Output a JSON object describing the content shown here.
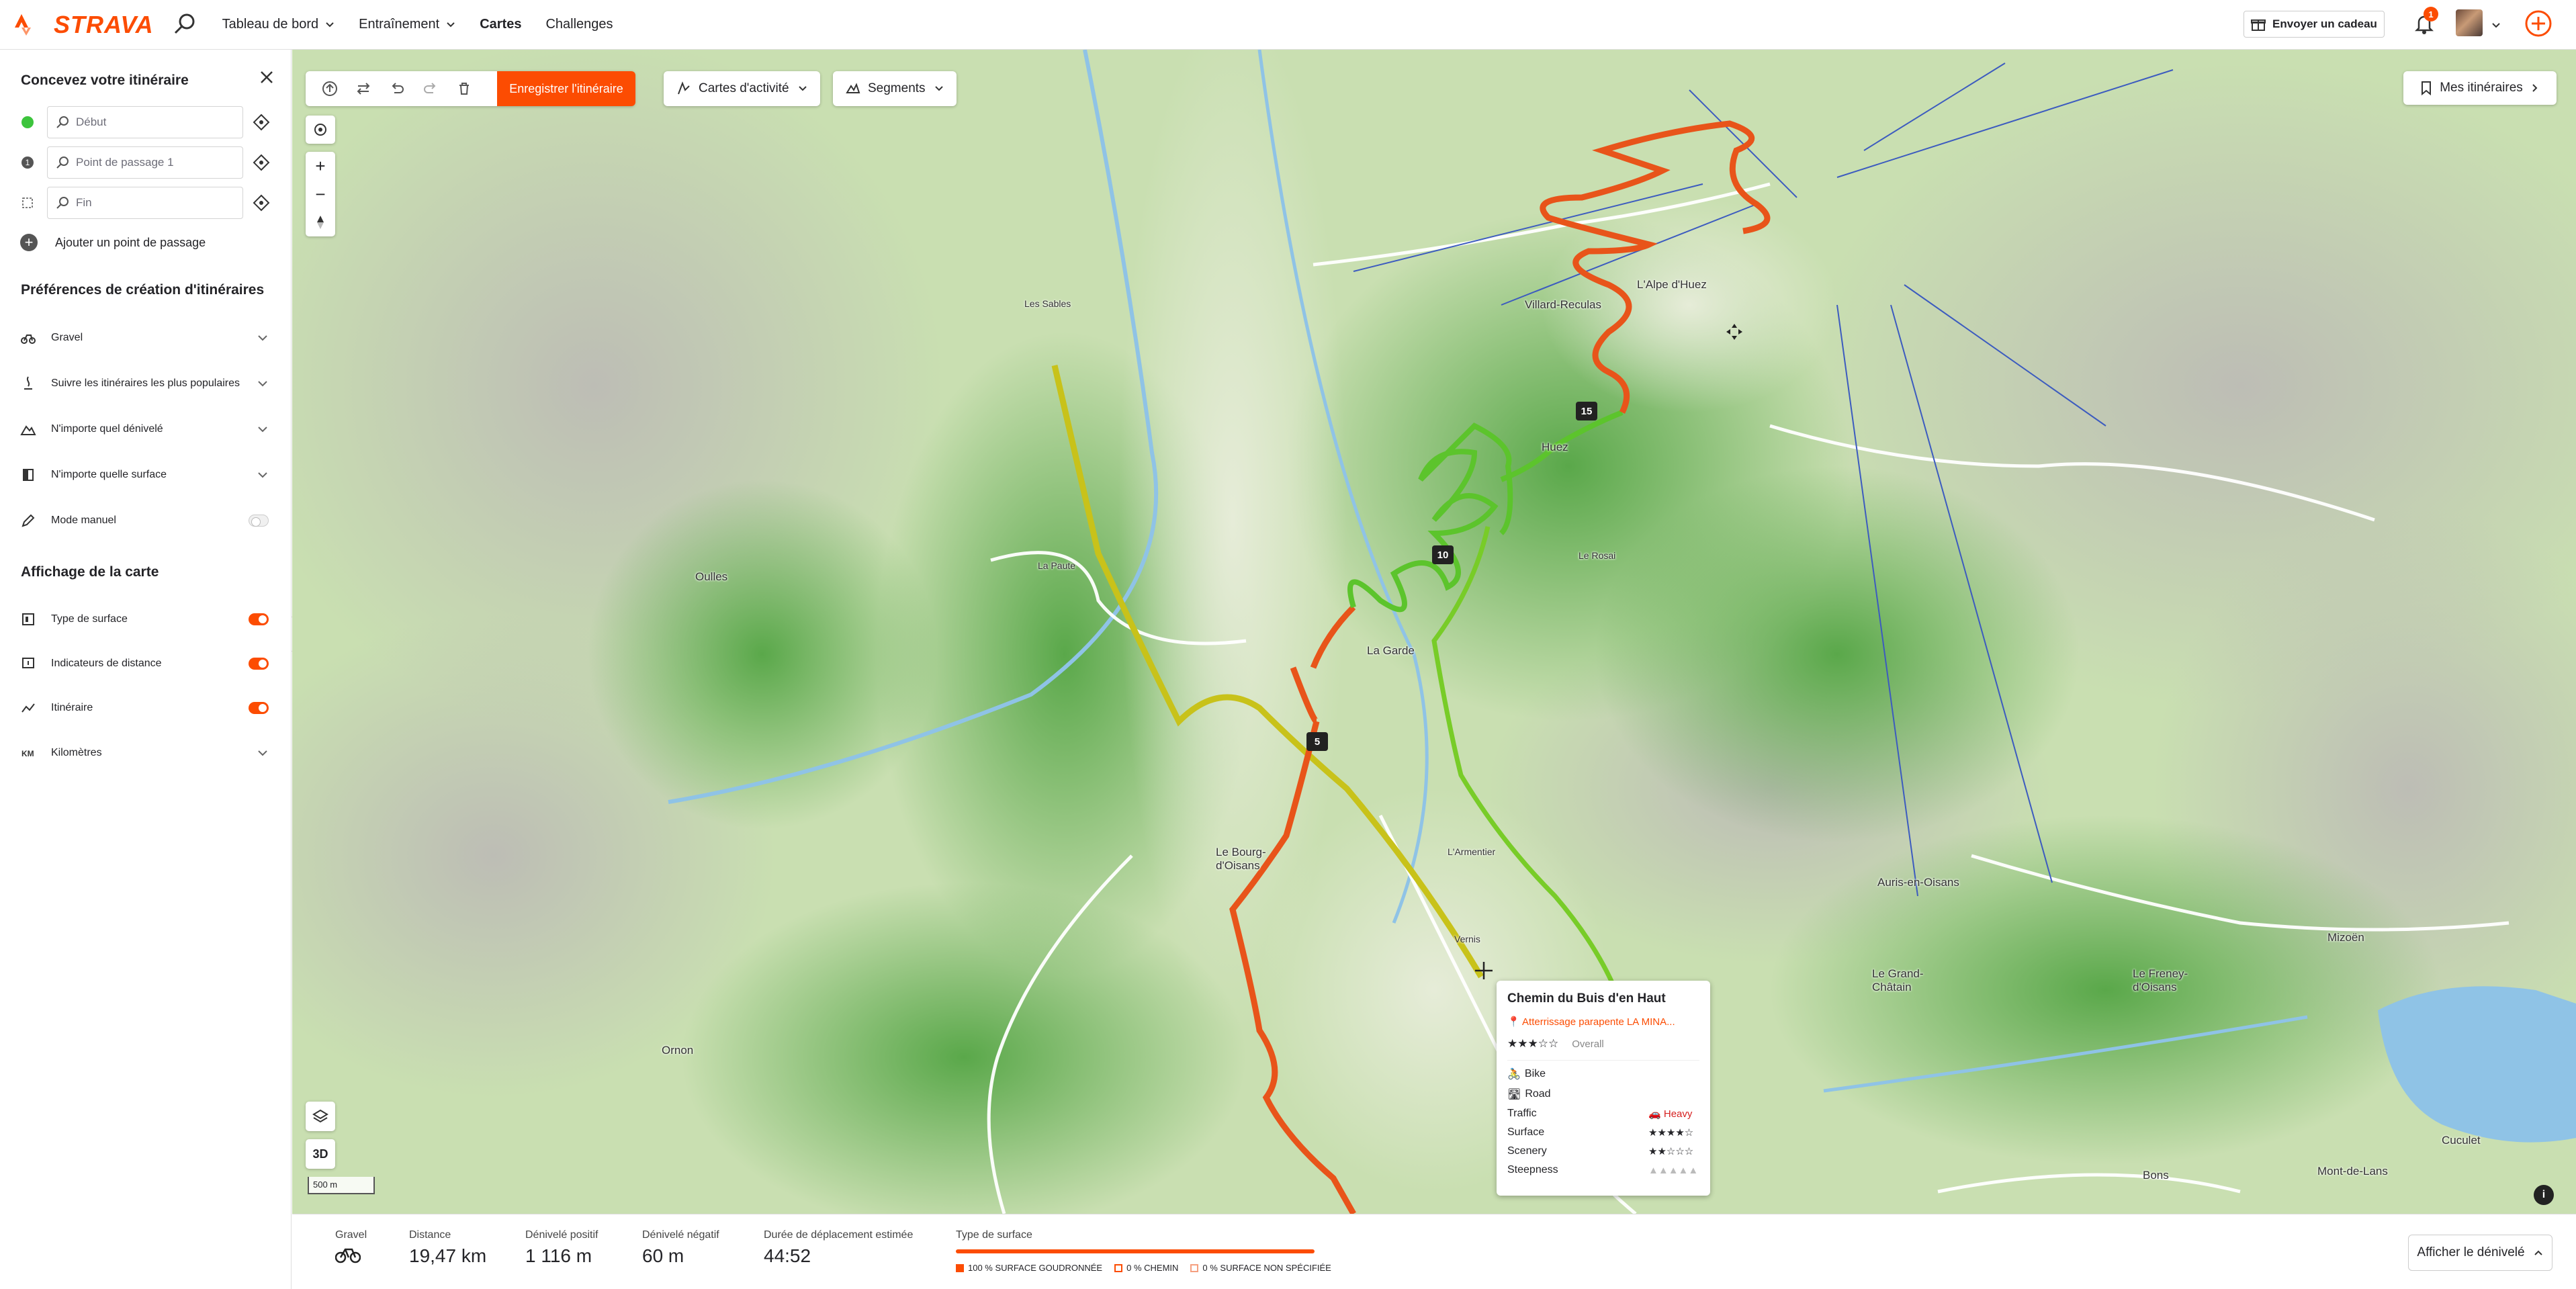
{
  "nav": {
    "brand": "STRAVA",
    "items": [
      {
        "label": "Tableau de bord"
      },
      {
        "label": "Entraînement"
      },
      {
        "label": "Cartes"
      },
      {
        "label": "Challenges"
      }
    ],
    "gift_label": "Envoyer un cadeau",
    "notifications": "1"
  },
  "sidebar": {
    "title": "Concevez votre itinéraire",
    "waypoints": [
      {
        "placeholder": "Début"
      },
      {
        "placeholder": "Point de passage 1"
      },
      {
        "placeholder": "Fin"
      }
    ],
    "add_waypoint": "Ajouter un point de passage",
    "prefs_title": "Préférences de création d'itinéraires",
    "prefs": [
      {
        "label": "Gravel"
      },
      {
        "label": "Suivre les itinéraires les plus populaires"
      },
      {
        "label": "N'importe quel dénivelé"
      },
      {
        "label": "N'importe quelle surface"
      },
      {
        "label": "Mode manuel"
      }
    ],
    "display_title": "Affichage de la carte",
    "display": [
      {
        "label": "Type de surface",
        "on": true
      },
      {
        "label": "Indicateurs de distance",
        "on": true
      },
      {
        "label": "Itinéraire",
        "on": true
      },
      {
        "label": "Kilomètres"
      }
    ]
  },
  "toolbar": {
    "save_label": "Enregistrer l'itinéraire",
    "activity_maps": "Cartes d'activité",
    "segments": "Segments",
    "my_routes": "Mes itinéraires"
  },
  "map": {
    "btn_3d": "3D",
    "scale": "500 m",
    "info": "i",
    "labels": {
      "alpe": "L'Alpe d'Huez",
      "huez": "Huez",
      "villard": "Villard-Reculas",
      "sables": "Les Sables",
      "paute": "La Paute",
      "oulles": "Oulles",
      "garde": "La Garde",
      "rosai": "Le Rosai",
      "bourg": "Le Bourg-d'Oisans",
      "auris": "Auris-en-Oisans",
      "chatain": "Le Grand-Châtain",
      "freney": "Le Freney-d'Oisans",
      "mizoen": "Mizoën",
      "ornon": "Ornon",
      "bons": "Bons",
      "mont": "Mont-de-Lans",
      "cuculet": "Cuculet",
      "armentier": "L'Armentier",
      "vernis": "Vernis"
    },
    "km_markers": [
      "5",
      "10",
      "15"
    ]
  },
  "popup": {
    "title": "Chemin du Buis d'en Haut",
    "location": "Atterrissage parapente LA MINA...",
    "overall_label": "Overall",
    "overall_stars": "★★★☆☆",
    "bike": "Bike",
    "road": "Road",
    "traffic_label": "Traffic",
    "traffic_value": "Heavy",
    "surface_label": "Surface",
    "surface_value": "★★★★☆",
    "scenery_label": "Scenery",
    "scenery_value": "★★☆☆☆",
    "steepness_label": "Steepness",
    "steepness_value": "▲▲▲▲▲"
  },
  "stats": {
    "sport_label": "Gravel",
    "distance_label": "Distance",
    "distance_value": "19,47 km",
    "gain_label": "Dénivelé positif",
    "gain_value": "1 116 m",
    "loss_label": "Dénivelé négatif",
    "loss_value": "60 m",
    "time_label": "Durée de déplacement estimée",
    "time_value": "44:52",
    "surface_label": "Type de surface",
    "surface_fractions": {
      "paved": 1.0,
      "unpaved": 0.0,
      "unknown": 0.0
    },
    "legend_paved": "100 % SURFACE GOUDRONNÉE",
    "legend_unpaved": "0 % CHEMIN",
    "legend_unknown": "0 % SURFACE NON SPÉCIFIÉE",
    "elevation_button": "Afficher le dénivelé"
  },
  "colors": {
    "accent": "#fc4c02",
    "route_paved": "#e8541a",
    "route_segment": "#5cc42c",
    "route_yellow": "#c8c21a"
  }
}
